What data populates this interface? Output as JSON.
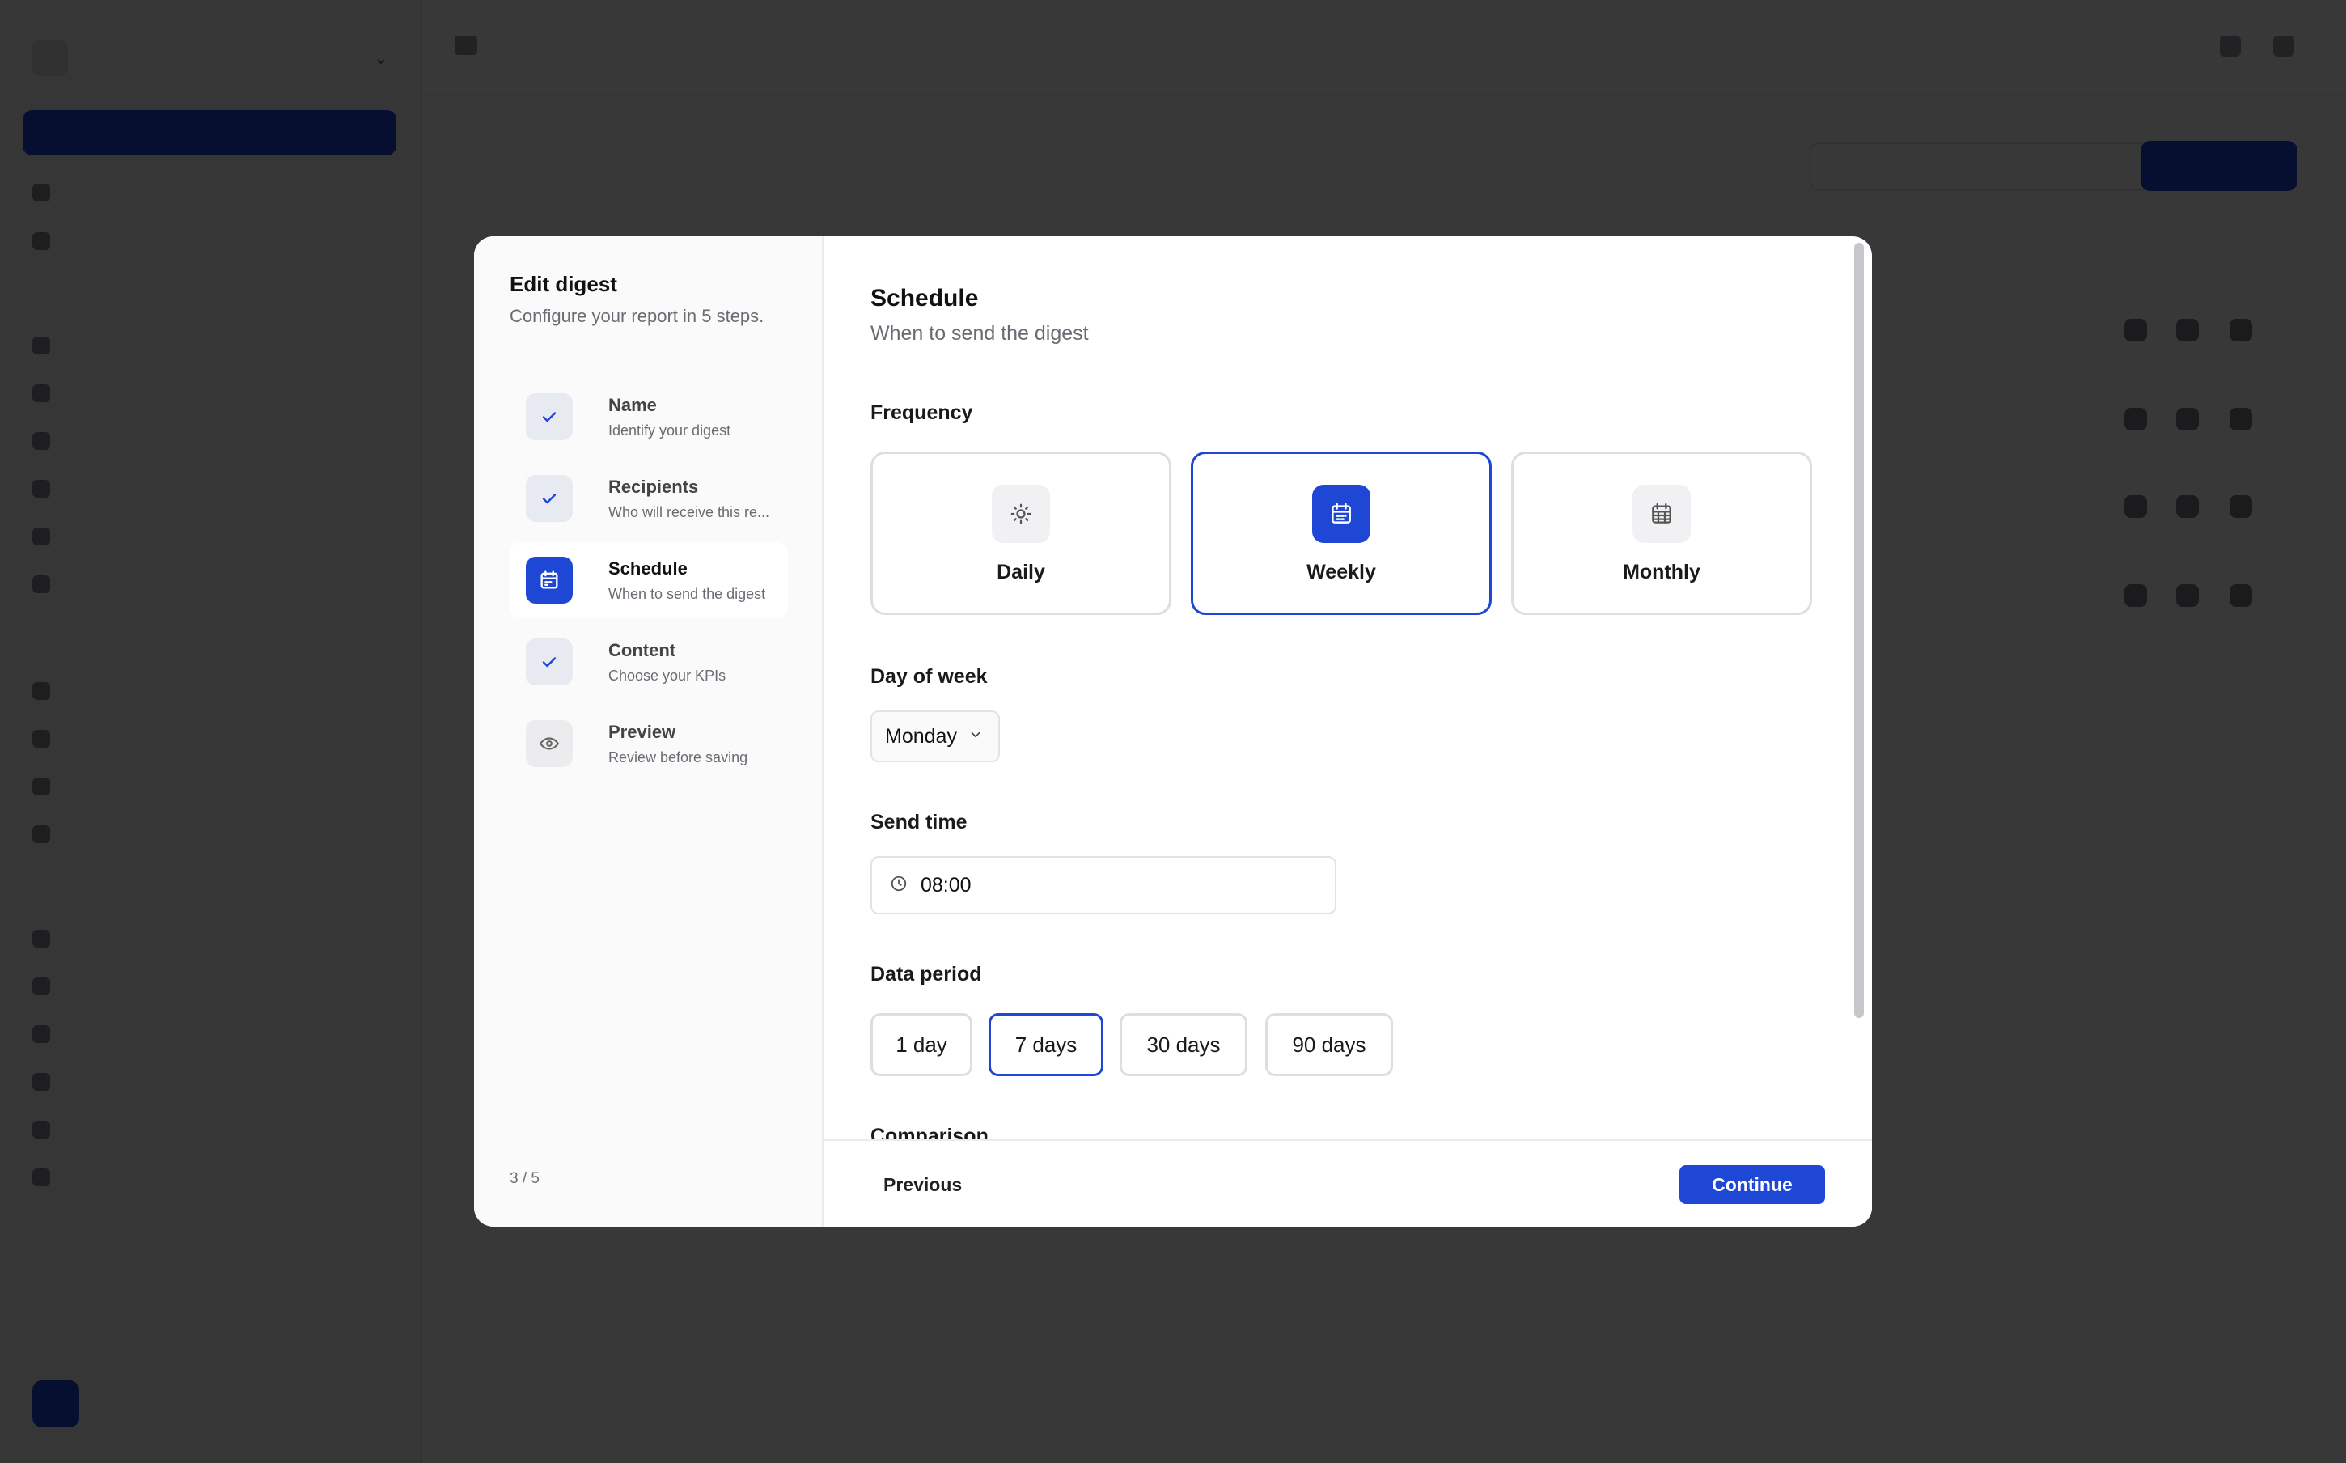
{
  "background": {
    "workspace_name": "",
    "page_title": "",
    "page_subtitle": ""
  },
  "modal": {
    "title": "Edit digest",
    "subtitle": "Configure your report in 5 steps.",
    "steps": [
      {
        "label": "Name",
        "desc": "Identify your digest",
        "state": "done",
        "icon": "check-icon"
      },
      {
        "label": "Recipients",
        "desc": "Who will receive this re...",
        "state": "done",
        "icon": "check-icon"
      },
      {
        "label": "Schedule",
        "desc": "When to send the digest",
        "state": "active",
        "icon": "calendar-icon"
      },
      {
        "label": "Content",
        "desc": "Choose your KPIs",
        "state": "done",
        "icon": "check-icon"
      },
      {
        "label": "Preview",
        "desc": "Review before saving",
        "state": "pending",
        "icon": "eye-icon"
      }
    ],
    "step_counter": "3 / 5",
    "content": {
      "title": "Schedule",
      "subtitle": "When to send the digest",
      "frequency_label": "Frequency",
      "frequency_options": [
        {
          "label": "Daily",
          "icon": "sun-icon",
          "selected": false
        },
        {
          "label": "Weekly",
          "icon": "calendar-icon",
          "selected": true
        },
        {
          "label": "Monthly",
          "icon": "calendar-grid-icon",
          "selected": false
        }
      ],
      "day_label": "Day of week",
      "day_value": "Monday",
      "time_label": "Send time",
      "time_value": "08:00",
      "period_label": "Data period",
      "period_options": [
        {
          "label": "1 day",
          "selected": false
        },
        {
          "label": "7 days",
          "selected": true
        },
        {
          "label": "30 days",
          "selected": false
        },
        {
          "label": "90 days",
          "selected": false
        }
      ],
      "comparison_label": "Comparison"
    },
    "footer": {
      "previous": "Previous",
      "continue": "Continue"
    }
  },
  "colors": {
    "accent": "#1f47d6",
    "overlay": "rgba(0,0,0,0.78)"
  }
}
